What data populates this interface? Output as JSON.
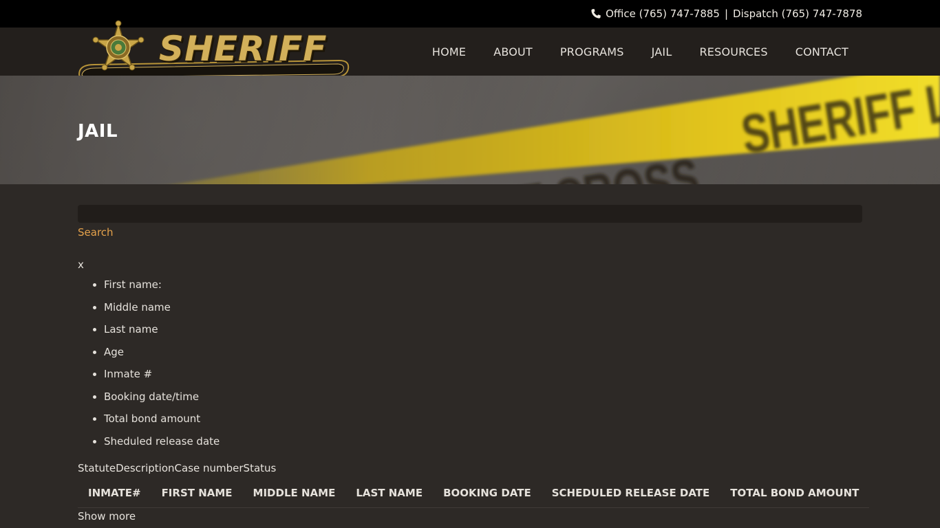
{
  "topbar": {
    "office_label": "Office (765) 747-7885",
    "separator": "|",
    "dispatch_label": "Dispatch (765) 747-7878",
    "icon": "phone-icon"
  },
  "header": {
    "logo_text": "SHERIFF",
    "nav": [
      "HOME",
      "ABOUT",
      "PROGRAMS",
      "JAIL",
      "RESOURCES",
      "CONTACT"
    ]
  },
  "hero": {
    "title": "JAIL",
    "tape_text_1": "DO NOT CROSS",
    "tape_text_2": "SHERIFF LINE D"
  },
  "search": {
    "input_value": "",
    "link_label": "Search"
  },
  "details": {
    "close_label": "x",
    "fields": [
      "First name:",
      "Middle name",
      "Last name",
      "Age",
      "Inmate #",
      "Booking date/time",
      "Total bond amount",
      "Sheduled release date"
    ],
    "case_headers": "StatuteDescriptionCase numberStatus"
  },
  "table": {
    "columns": [
      "INMATE#",
      "FIRST NAME",
      "MIDDLE NAME",
      "LAST NAME",
      "BOOKING DATE",
      "SCHEDULED RELEASE DATE",
      "TOTAL BOND AMOUNT"
    ],
    "show_more_label": "Show more"
  },
  "colors": {
    "background": "#2d2926",
    "header": "#231f1c",
    "accent_link": "#e5a24b",
    "logo_gold": "#d2b05a"
  }
}
